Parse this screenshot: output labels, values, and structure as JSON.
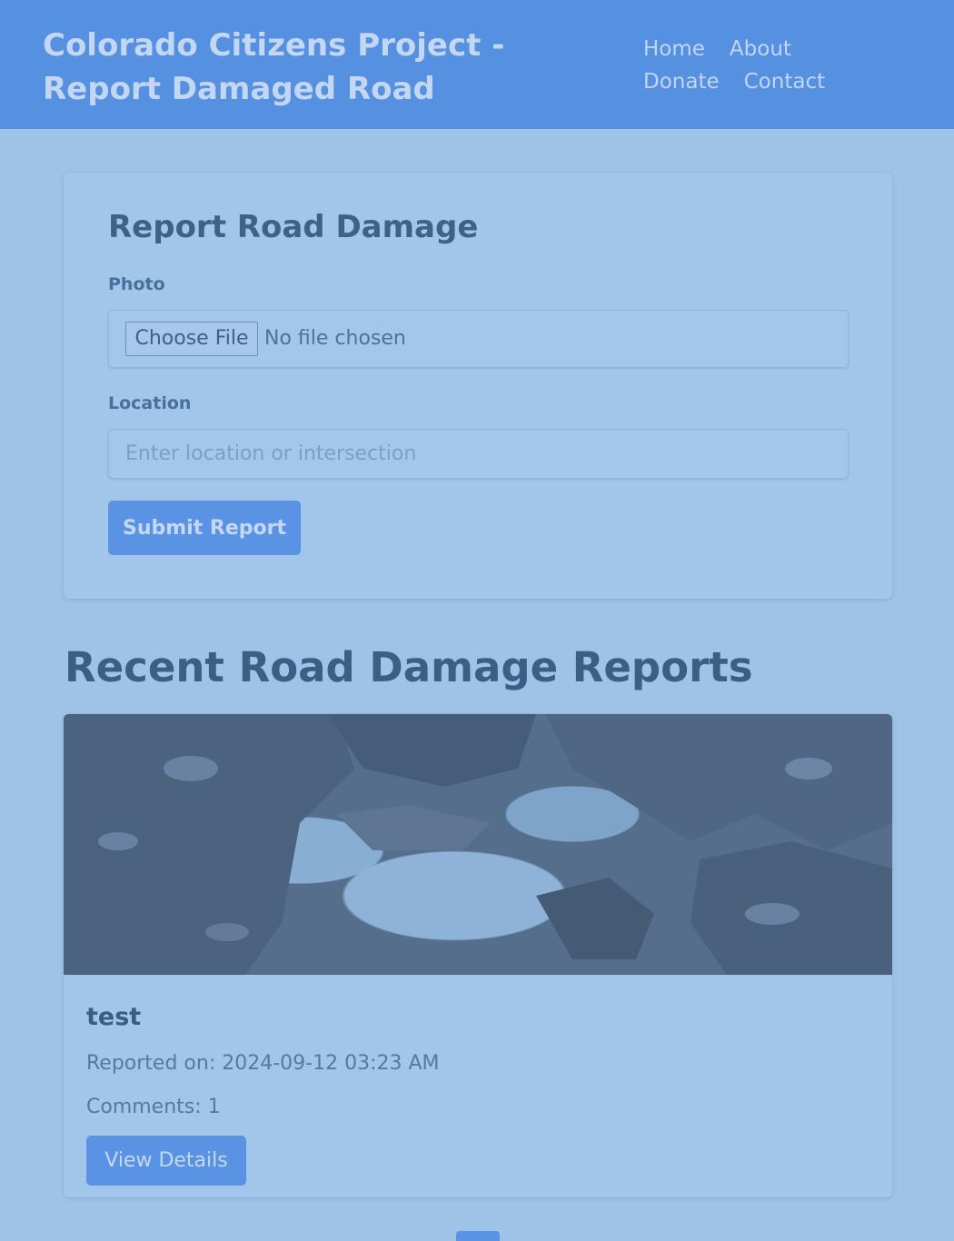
{
  "header": {
    "title": "Colorado Citizens Project - Report Damaged Road",
    "nav": [
      "Home",
      "About",
      "Donate",
      "Contact"
    ]
  },
  "form": {
    "title": "Report Road Damage",
    "photo_label": "Photo",
    "choose_file_label": "Choose File",
    "file_status": "No file chosen",
    "location_label": "Location",
    "location_placeholder": "Enter location or intersection",
    "location_value": "",
    "submit_label": "Submit Report"
  },
  "reports": {
    "title": "Recent Road Damage Reports",
    "items": [
      {
        "name": "test",
        "reported_on": "Reported on: 2024-09-12 03:23 AM",
        "comments": "Comments: 1",
        "details_label": "View Details",
        "photo_icon": "pothole-photo"
      }
    ]
  },
  "colors": {
    "header": "#5690e0",
    "page_background": "#9fc2e7",
    "card": "#a2c6e9",
    "button": "#5a93e3"
  }
}
